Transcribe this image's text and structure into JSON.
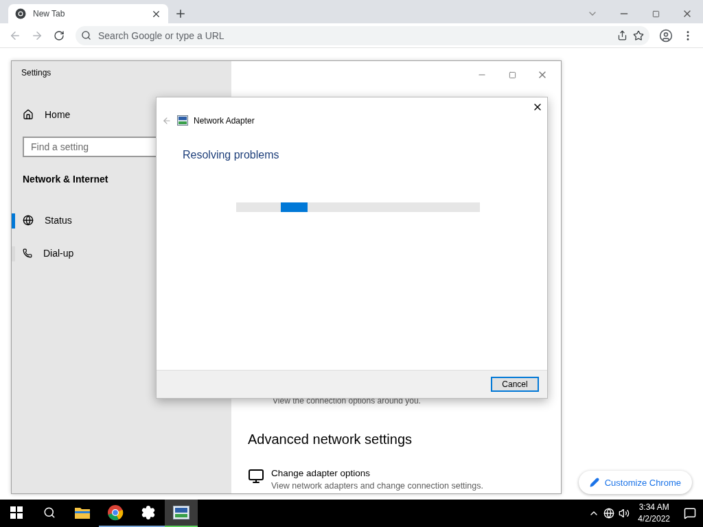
{
  "browser": {
    "tab": {
      "title": "New Tab",
      "selected": true
    },
    "address": {
      "placeholder": "Search Google or type a URL"
    },
    "customize_button": {
      "label": "Customize Chrome"
    }
  },
  "settings_window": {
    "title": "Settings",
    "home": "Home",
    "search": {
      "placeholder": "Find a setting"
    },
    "section_title": "Network & Internet",
    "nav_items": [
      {
        "label": "Status",
        "selected": true
      },
      {
        "label": "Dial-up",
        "selected": false
      }
    ],
    "partial_text": "View the connection options around you.",
    "heading": "Advanced network settings",
    "options": [
      {
        "title": "Change adapter options",
        "description": "View network adapters and change connection settings."
      }
    ]
  },
  "dialog": {
    "title": "Network Adapter",
    "heading": "Resolving problems",
    "progress": {
      "kind": "marquee"
    },
    "buttons": [
      {
        "label": "Cancel",
        "focused": true
      }
    ]
  },
  "taskbar": {
    "apps": [
      {
        "kind": "start",
        "running": false,
        "active": false
      },
      {
        "kind": "search",
        "running": false,
        "active": false
      },
      {
        "kind": "folder",
        "running": false,
        "active": false
      },
      {
        "kind": "chrome",
        "running": true,
        "active": false
      },
      {
        "kind": "gear",
        "running": true,
        "active": false
      },
      {
        "kind": "troubleshooter",
        "running": true,
        "active": true
      }
    ],
    "time": "3:34 AM",
    "date": "4/2/2022"
  }
}
